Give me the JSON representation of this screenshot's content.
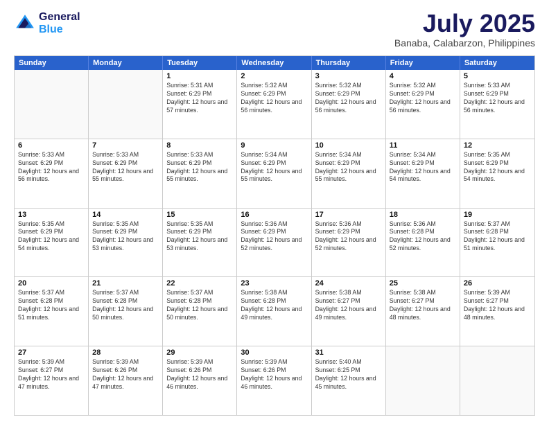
{
  "header": {
    "logo_line1": "General",
    "logo_line2": "Blue",
    "month_year": "July 2025",
    "location": "Banaba, Calabarzon, Philippines"
  },
  "days_of_week": [
    "Sunday",
    "Monday",
    "Tuesday",
    "Wednesday",
    "Thursday",
    "Friday",
    "Saturday"
  ],
  "weeks": [
    [
      {
        "day": "",
        "empty": true
      },
      {
        "day": "",
        "empty": true
      },
      {
        "day": "1",
        "sunrise": "5:31 AM",
        "sunset": "6:29 PM",
        "daylight": "12 hours and 57 minutes."
      },
      {
        "day": "2",
        "sunrise": "5:32 AM",
        "sunset": "6:29 PM",
        "daylight": "12 hours and 56 minutes."
      },
      {
        "day": "3",
        "sunrise": "5:32 AM",
        "sunset": "6:29 PM",
        "daylight": "12 hours and 56 minutes."
      },
      {
        "day": "4",
        "sunrise": "5:32 AM",
        "sunset": "6:29 PM",
        "daylight": "12 hours and 56 minutes."
      },
      {
        "day": "5",
        "sunrise": "5:33 AM",
        "sunset": "6:29 PM",
        "daylight": "12 hours and 56 minutes."
      }
    ],
    [
      {
        "day": "6",
        "sunrise": "5:33 AM",
        "sunset": "6:29 PM",
        "daylight": "12 hours and 56 minutes."
      },
      {
        "day": "7",
        "sunrise": "5:33 AM",
        "sunset": "6:29 PM",
        "daylight": "12 hours and 55 minutes."
      },
      {
        "day": "8",
        "sunrise": "5:33 AM",
        "sunset": "6:29 PM",
        "daylight": "12 hours and 55 minutes."
      },
      {
        "day": "9",
        "sunrise": "5:34 AM",
        "sunset": "6:29 PM",
        "daylight": "12 hours and 55 minutes."
      },
      {
        "day": "10",
        "sunrise": "5:34 AM",
        "sunset": "6:29 PM",
        "daylight": "12 hours and 55 minutes."
      },
      {
        "day": "11",
        "sunrise": "5:34 AM",
        "sunset": "6:29 PM",
        "daylight": "12 hours and 54 minutes."
      },
      {
        "day": "12",
        "sunrise": "5:35 AM",
        "sunset": "6:29 PM",
        "daylight": "12 hours and 54 minutes."
      }
    ],
    [
      {
        "day": "13",
        "sunrise": "5:35 AM",
        "sunset": "6:29 PM",
        "daylight": "12 hours and 54 minutes."
      },
      {
        "day": "14",
        "sunrise": "5:35 AM",
        "sunset": "6:29 PM",
        "daylight": "12 hours and 53 minutes."
      },
      {
        "day": "15",
        "sunrise": "5:35 AM",
        "sunset": "6:29 PM",
        "daylight": "12 hours and 53 minutes."
      },
      {
        "day": "16",
        "sunrise": "5:36 AM",
        "sunset": "6:29 PM",
        "daylight": "12 hours and 52 minutes."
      },
      {
        "day": "17",
        "sunrise": "5:36 AM",
        "sunset": "6:29 PM",
        "daylight": "12 hours and 52 minutes."
      },
      {
        "day": "18",
        "sunrise": "5:36 AM",
        "sunset": "6:28 PM",
        "daylight": "12 hours and 52 minutes."
      },
      {
        "day": "19",
        "sunrise": "5:37 AM",
        "sunset": "6:28 PM",
        "daylight": "12 hours and 51 minutes."
      }
    ],
    [
      {
        "day": "20",
        "sunrise": "5:37 AM",
        "sunset": "6:28 PM",
        "daylight": "12 hours and 51 minutes."
      },
      {
        "day": "21",
        "sunrise": "5:37 AM",
        "sunset": "6:28 PM",
        "daylight": "12 hours and 50 minutes."
      },
      {
        "day": "22",
        "sunrise": "5:37 AM",
        "sunset": "6:28 PM",
        "daylight": "12 hours and 50 minutes."
      },
      {
        "day": "23",
        "sunrise": "5:38 AM",
        "sunset": "6:28 PM",
        "daylight": "12 hours and 49 minutes."
      },
      {
        "day": "24",
        "sunrise": "5:38 AM",
        "sunset": "6:27 PM",
        "daylight": "12 hours and 49 minutes."
      },
      {
        "day": "25",
        "sunrise": "5:38 AM",
        "sunset": "6:27 PM",
        "daylight": "12 hours and 48 minutes."
      },
      {
        "day": "26",
        "sunrise": "5:39 AM",
        "sunset": "6:27 PM",
        "daylight": "12 hours and 48 minutes."
      }
    ],
    [
      {
        "day": "27",
        "sunrise": "5:39 AM",
        "sunset": "6:27 PM",
        "daylight": "12 hours and 47 minutes."
      },
      {
        "day": "28",
        "sunrise": "5:39 AM",
        "sunset": "6:26 PM",
        "daylight": "12 hours and 47 minutes."
      },
      {
        "day": "29",
        "sunrise": "5:39 AM",
        "sunset": "6:26 PM",
        "daylight": "12 hours and 46 minutes."
      },
      {
        "day": "30",
        "sunrise": "5:39 AM",
        "sunset": "6:26 PM",
        "daylight": "12 hours and 46 minutes."
      },
      {
        "day": "31",
        "sunrise": "5:40 AM",
        "sunset": "6:25 PM",
        "daylight": "12 hours and 45 minutes."
      },
      {
        "day": "",
        "empty": true
      },
      {
        "day": "",
        "empty": true
      }
    ]
  ]
}
